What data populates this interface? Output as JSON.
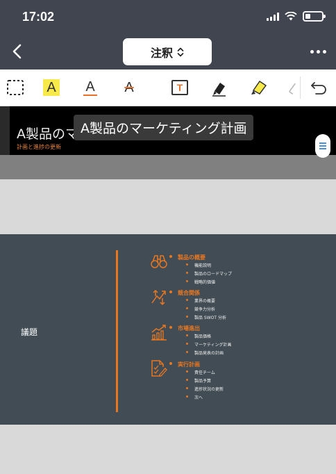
{
  "status": {
    "time": "17:02",
    "battery_level": 0.3
  },
  "nav": {
    "title": "注釈"
  },
  "toolbar": {
    "tools": [
      {
        "name": "select",
        "letter": ""
      },
      {
        "name": "highlight-text",
        "letter": "A"
      },
      {
        "name": "underline-text",
        "letter": "A"
      },
      {
        "name": "strikethrough-text",
        "letter": "A"
      },
      {
        "name": "text-box",
        "letter": "T"
      },
      {
        "name": "pen",
        "letter": ""
      },
      {
        "name": "highlighter",
        "letter": ""
      },
      {
        "name": "eraser",
        "letter": ""
      },
      {
        "name": "undo",
        "letter": ""
      }
    ]
  },
  "slide1": {
    "title": "A製品のマーケティング計画（20XX年）",
    "subtitle": "計画と進捗の更新",
    "popup_text": "A製品のマーケティング計画"
  },
  "slide2": {
    "agenda_label": "議題",
    "sections": [
      {
        "icon": "binoculars-icon",
        "title": "製品の概要",
        "items": [
          "機能説明",
          "製品のロードマップ",
          "戦略的価値"
        ]
      },
      {
        "icon": "arrows-icon",
        "title": "競合関係",
        "items": [
          "業界の概要",
          "競争力分析",
          "製品 SWOT 分析"
        ]
      },
      {
        "icon": "growth-chart-icon",
        "title": "市場進出",
        "items": [
          "製品価格",
          "マーケティング計画",
          "製品発表の計画"
        ]
      },
      {
        "icon": "document-edit-icon",
        "title": "実行計画",
        "items": [
          "責任チーム",
          "製品予算",
          "進捗状況の更新",
          "次へ"
        ]
      }
    ]
  },
  "colors": {
    "accent": "#e87722",
    "chrome": "#414550",
    "slide_bg": "#414c54"
  }
}
